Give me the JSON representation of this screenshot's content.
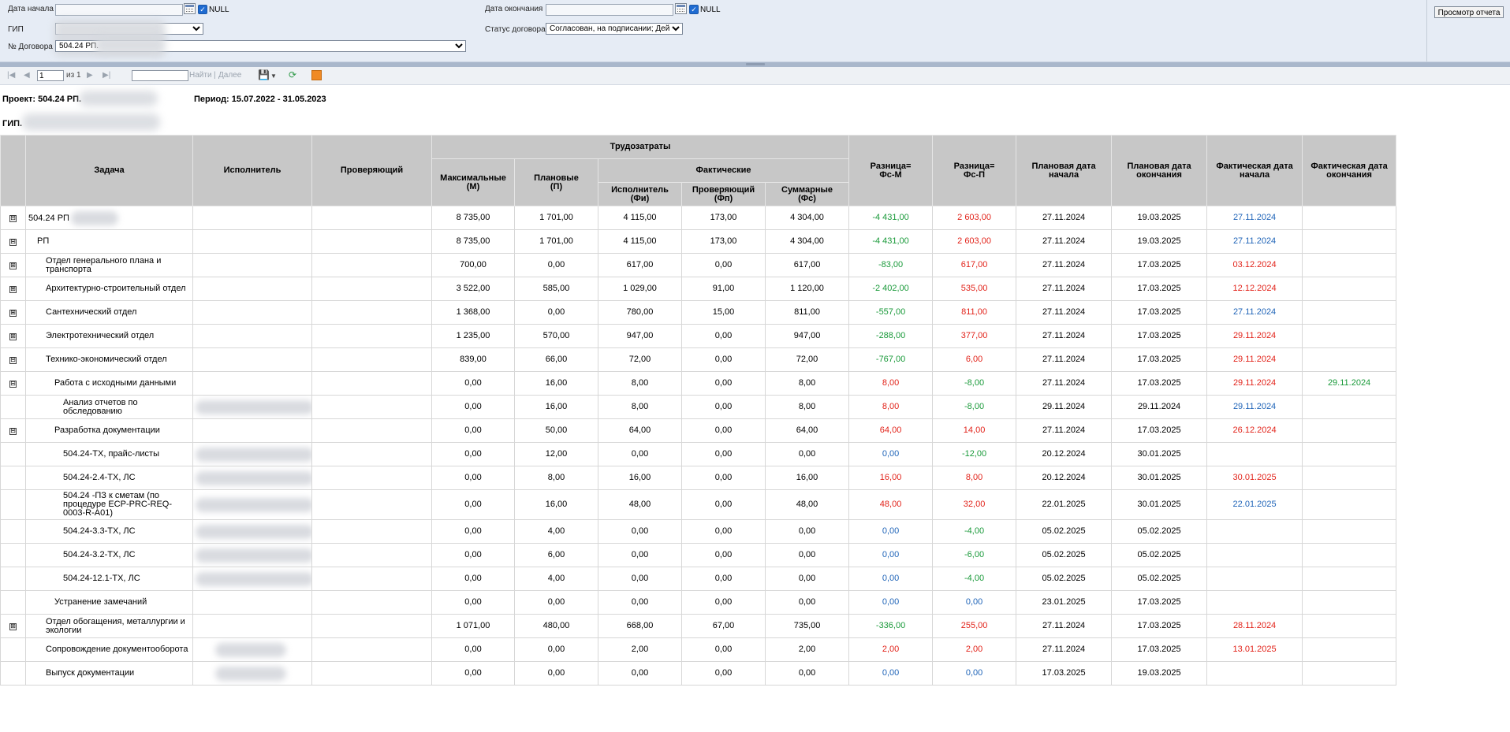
{
  "params": {
    "date_start_label": "Дата начала",
    "date_end_label": "Дата окончания",
    "null_label": "NULL",
    "gip_label": "ГИП",
    "status_label": "Статус договора",
    "status_value": "Согласован, на подписании; Дейст",
    "contract_label": "№ Договора",
    "contract_value": "504.24 РП.",
    "view_button": "Просмотр отчета"
  },
  "toolbar": {
    "page": "1",
    "of": "из 1",
    "find": "Найти",
    "sep": "|",
    "next": "Далее"
  },
  "report": {
    "project_label": "Проект: 504.24 РП.",
    "period_label": "Период: 15.07.2022 - 31.05.2023",
    "gip_label": "ГИП."
  },
  "columns": {
    "task": "Задача",
    "executor": "Исполнитель",
    "checker": "Проверяющий",
    "labor": "Трудозатраты",
    "max": "Максимальные\n(М)",
    "plan": "Плановые\n(П)",
    "actual": "Фактические",
    "act_exec": "Исполнитель\n(Фи)",
    "act_check": "Проверяющий\n(Фп)",
    "act_sum": "Суммарные\n(Фс)",
    "diff_m": "Разница=\nФс-М",
    "diff_p": "Разница=\nФс-П",
    "plan_start": "Плановая дата\nначала",
    "plan_end": "Плановая дата\nокончания",
    "fact_start": "Фактическая дата\nначала",
    "fact_end": "Фактическая дата\nокончания"
  },
  "colors": {
    "green": "#1a9a3a",
    "red": "#e2231a",
    "blue": "#1f64b8"
  },
  "rows": [
    {
      "toggle": "⊟",
      "indent": 0,
      "task": "504.24 РП",
      "blurTask": true,
      "m": "8 735,00",
      "p": "1 701,00",
      "fi": "4 115,00",
      "fp": "173,00",
      "fs": "4 304,00",
      "dm": "-4 431,00",
      "dmc": "g",
      "dp": "2 603,00",
      "dpc": "r",
      "ps": "27.11.2024",
      "pe": "19.03.2025",
      "fs_d": "27.11.2024",
      "fsc": "b",
      "fe": ""
    },
    {
      "toggle": "⊟",
      "indent": 1,
      "task": "РП",
      "m": "8 735,00",
      "p": "1 701,00",
      "fi": "4 115,00",
      "fp": "173,00",
      "fs": "4 304,00",
      "dm": "-4 431,00",
      "dmc": "g",
      "dp": "2 603,00",
      "dpc": "r",
      "ps": "27.11.2024",
      "pe": "19.03.2025",
      "fs_d": "27.11.2024",
      "fsc": "b",
      "fe": ""
    },
    {
      "toggle": "⊞",
      "indent": 2,
      "task": "Отдел генерального плана и транспорта",
      "m": "700,00",
      "p": "0,00",
      "fi": "617,00",
      "fp": "0,00",
      "fs": "617,00",
      "dm": "-83,00",
      "dmc": "g",
      "dp": "617,00",
      "dpc": "r",
      "ps": "27.11.2024",
      "pe": "17.03.2025",
      "fs_d": "03.12.2024",
      "fsc": "r",
      "fe": ""
    },
    {
      "toggle": "⊞",
      "indent": 2,
      "task": "Архитектурно-строительный отдел",
      "m": "3 522,00",
      "p": "585,00",
      "fi": "1 029,00",
      "fp": "91,00",
      "fs": "1 120,00",
      "dm": "-2 402,00",
      "dmc": "g",
      "dp": "535,00",
      "dpc": "r",
      "ps": "27.11.2024",
      "pe": "17.03.2025",
      "fs_d": "12.12.2024",
      "fsc": "r",
      "fe": ""
    },
    {
      "toggle": "⊞",
      "indent": 2,
      "task": "Сантехнический отдел",
      "m": "1 368,00",
      "p": "0,00",
      "fi": "780,00",
      "fp": "15,00",
      "fs": "811,00",
      "dm": "-557,00",
      "dmc": "g",
      "dp": "811,00",
      "dpc": "r",
      "ps": "27.11.2024",
      "pe": "17.03.2025",
      "fs_d": "27.11.2024",
      "fsc": "b",
      "fe": ""
    },
    {
      "toggle": "⊞",
      "indent": 2,
      "task": "Электротехнический отдел",
      "m": "1 235,00",
      "p": "570,00",
      "fi": "947,00",
      "fp": "0,00",
      "fs": "947,00",
      "dm": "-288,00",
      "dmc": "g",
      "dp": "377,00",
      "dpc": "r",
      "ps": "27.11.2024",
      "pe": "17.03.2025",
      "fs_d": "29.11.2024",
      "fsc": "r",
      "fe": ""
    },
    {
      "toggle": "⊟",
      "indent": 2,
      "task": "Технико-экономический отдел",
      "m": "839,00",
      "p": "66,00",
      "fi": "72,00",
      "fp": "0,00",
      "fs": "72,00",
      "dm": "-767,00",
      "dmc": "g",
      "dp": "6,00",
      "dpc": "r",
      "ps": "27.11.2024",
      "pe": "17.03.2025",
      "fs_d": "29.11.2024",
      "fsc": "r",
      "fe": ""
    },
    {
      "toggle": "⊟",
      "indent": 3,
      "task": "Работа с исходными данными",
      "m": "0,00",
      "p": "16,00",
      "fi": "8,00",
      "fp": "0,00",
      "fs": "8,00",
      "dm": "8,00",
      "dmc": "r",
      "dp": "-8,00",
      "dpc": "g",
      "ps": "27.11.2024",
      "pe": "17.03.2025",
      "fs_d": "29.11.2024",
      "fsc": "r",
      "fe": "29.11.2024"
    },
    {
      "toggle": "",
      "indent": 4,
      "task": "Анализ отчетов по обследованию",
      "blurExec": true,
      "m": "0,00",
      "p": "16,00",
      "fi": "8,00",
      "fp": "0,00",
      "fs": "8,00",
      "dm": "8,00",
      "dmc": "r",
      "dp": "-8,00",
      "dpc": "g",
      "ps": "29.11.2024",
      "pe": "29.11.2024",
      "fs_d": "29.11.2024",
      "fsc": "b",
      "fe": ""
    },
    {
      "toggle": "⊟",
      "indent": 3,
      "task": "Разработка документации",
      "m": "0,00",
      "p": "50,00",
      "fi": "64,00",
      "fp": "0,00",
      "fs": "64,00",
      "dm": "64,00",
      "dmc": "r",
      "dp": "14,00",
      "dpc": "r",
      "ps": "27.11.2024",
      "pe": "17.03.2025",
      "fs_d": "26.12.2024",
      "fsc": "r",
      "fe": ""
    },
    {
      "toggle": "",
      "indent": 4,
      "task": "504.24-ТХ, прайс-листы",
      "blurExec": true,
      "m": "0,00",
      "p": "12,00",
      "fi": "0,00",
      "fp": "0,00",
      "fs": "0,00",
      "dm": "0,00",
      "dmc": "b",
      "dp": "-12,00",
      "dpc": "g",
      "ps": "20.12.2024",
      "pe": "30.01.2025",
      "fs_d": "",
      "fsc": "",
      "fe": ""
    },
    {
      "toggle": "",
      "indent": 4,
      "task": "504.24-2.4-ТХ, ЛС",
      "blurExec": true,
      "m": "0,00",
      "p": "8,00",
      "fi": "16,00",
      "fp": "0,00",
      "fs": "16,00",
      "dm": "16,00",
      "dmc": "r",
      "dp": "8,00",
      "dpc": "r",
      "ps": "20.12.2024",
      "pe": "30.01.2025",
      "fs_d": "30.01.2025",
      "fsc": "r",
      "fe": ""
    },
    {
      "toggle": "",
      "indent": 4,
      "task": "504.24 -ПЗ к сметам (по процедуре ECP-PRC-REQ-0003-R-A01)",
      "blurExec": true,
      "tall": true,
      "m": "0,00",
      "p": "16,00",
      "fi": "48,00",
      "fp": "0,00",
      "fs": "48,00",
      "dm": "48,00",
      "dmc": "r",
      "dp": "32,00",
      "dpc": "r",
      "ps": "22.01.2025",
      "pe": "30.01.2025",
      "fs_d": "22.01.2025",
      "fsc": "b",
      "fe": ""
    },
    {
      "toggle": "",
      "indent": 4,
      "task": "504.24-3.3-ТХ, ЛС",
      "blurExec": true,
      "m": "0,00",
      "p": "4,00",
      "fi": "0,00",
      "fp": "0,00",
      "fs": "0,00",
      "dm": "0,00",
      "dmc": "b",
      "dp": "-4,00",
      "dpc": "g",
      "ps": "05.02.2025",
      "pe": "05.02.2025",
      "fs_d": "",
      "fsc": "",
      "fe": ""
    },
    {
      "toggle": "",
      "indent": 4,
      "task": "504.24-3.2-ТХ, ЛС",
      "blurExec": true,
      "m": "0,00",
      "p": "6,00",
      "fi": "0,00",
      "fp": "0,00",
      "fs": "0,00",
      "dm": "0,00",
      "dmc": "b",
      "dp": "-6,00",
      "dpc": "g",
      "ps": "05.02.2025",
      "pe": "05.02.2025",
      "fs_d": "",
      "fsc": "",
      "fe": ""
    },
    {
      "toggle": "",
      "indent": 4,
      "task": "504.24-12.1-ТХ, ЛС",
      "blurExec": true,
      "m": "0,00",
      "p": "4,00",
      "fi": "0,00",
      "fp": "0,00",
      "fs": "0,00",
      "dm": "0,00",
      "dmc": "b",
      "dp": "-4,00",
      "dpc": "g",
      "ps": "05.02.2025",
      "pe": "05.02.2025",
      "fs_d": "",
      "fsc": "",
      "fe": ""
    },
    {
      "toggle": "",
      "indent": 3,
      "task": "Устранение замечаний",
      "m": "0,00",
      "p": "0,00",
      "fi": "0,00",
      "fp": "0,00",
      "fs": "0,00",
      "dm": "0,00",
      "dmc": "b",
      "dp": "0,00",
      "dpc": "b",
      "ps": "23.01.2025",
      "pe": "17.03.2025",
      "fs_d": "",
      "fsc": "",
      "fe": ""
    },
    {
      "toggle": "⊞",
      "indent": 2,
      "task": "Отдел обогащения, металлургии и экологии",
      "m": "1 071,00",
      "p": "480,00",
      "fi": "668,00",
      "fp": "67,00",
      "fs": "735,00",
      "dm": "-336,00",
      "dmc": "g",
      "dp": "255,00",
      "dpc": "r",
      "ps": "27.11.2024",
      "pe": "17.03.2025",
      "fs_d": "28.11.2024",
      "fsc": "r",
      "fe": ""
    },
    {
      "toggle": "",
      "indent": 2,
      "task": "Сопровождение документооборота",
      "blurExec": true,
      "m": "0,00",
      "p": "0,00",
      "fi": "2,00",
      "fp": "0,00",
      "fs": "2,00",
      "dm": "2,00",
      "dmc": "r",
      "dp": "2,00",
      "dpc": "r",
      "ps": "27.11.2024",
      "pe": "17.03.2025",
      "fs_d": "13.01.2025",
      "fsc": "r",
      "fe": ""
    },
    {
      "toggle": "",
      "indent": 2,
      "task": "Выпуск документации",
      "blurExec": true,
      "m": "0,00",
      "p": "0,00",
      "fi": "0,00",
      "fp": "0,00",
      "fs": "0,00",
      "dm": "0,00",
      "dmc": "b",
      "dp": "0,00",
      "dpc": "b",
      "ps": "17.03.2025",
      "pe": "19.03.2025",
      "fs_d": "",
      "fsc": "",
      "fe": ""
    }
  ]
}
